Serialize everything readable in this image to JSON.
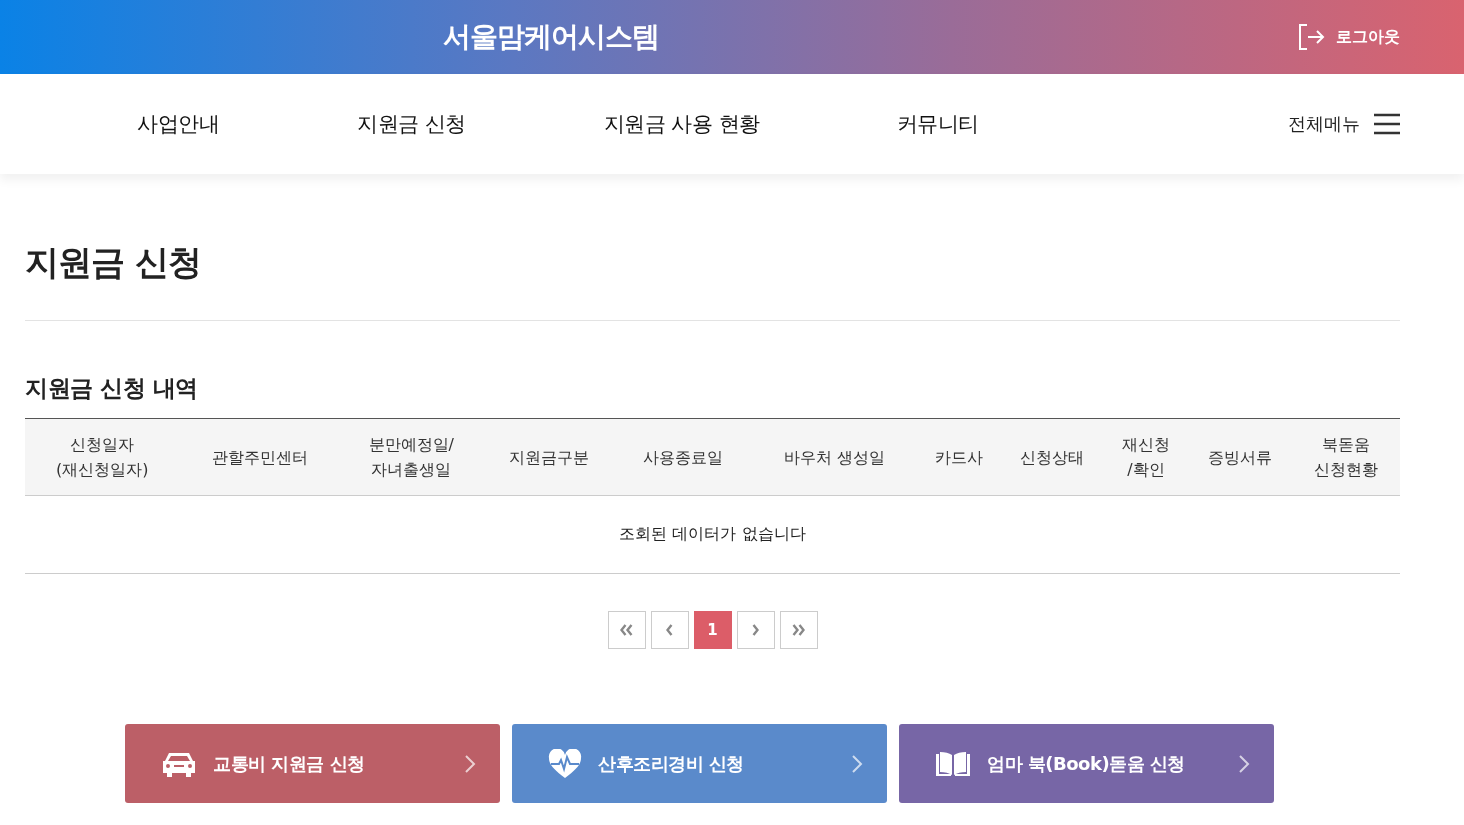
{
  "header": {
    "title": "서울맘케어시스템",
    "logout": "로그아웃"
  },
  "nav": {
    "items": [
      {
        "label": "사업안내"
      },
      {
        "label": "지원금 신청"
      },
      {
        "label": "지원금 사용 현황"
      },
      {
        "label": "커뮤니티"
      }
    ],
    "all_menu": "전체메뉴"
  },
  "page_title": "지원금 신청",
  "section_title": "지원금 신청 내역",
  "table": {
    "columns": [
      {
        "label": "신청일자\n(재신청일자)"
      },
      {
        "label": "관할주민센터"
      },
      {
        "label": "분만예정일/\n자녀출생일"
      },
      {
        "label": "지원금구분"
      },
      {
        "label": "사용종료일"
      },
      {
        "label": "바우처 생성일"
      },
      {
        "label": "카드사"
      },
      {
        "label": "신청상태"
      },
      {
        "label": "재신청\n/확인"
      },
      {
        "label": "증빙서류"
      },
      {
        "label": "북돋움\n신청현황"
      }
    ],
    "empty_message": "조회된 데이터가 없습니다"
  },
  "pagination": [
    {
      "kind": "first"
    },
    {
      "kind": "prev"
    },
    {
      "kind": "page",
      "label": "1",
      "selected": true
    },
    {
      "kind": "next"
    },
    {
      "kind": "last"
    }
  ],
  "quick_links": [
    {
      "kind": "car",
      "label": "교통비 지원금 신청",
      "color": "#bc5f67"
    },
    {
      "kind": "heart",
      "label": "산후조리경비 신청",
      "color": "#5a8acb"
    },
    {
      "kind": "book",
      "label": "엄마 북(Book)돋움 신청",
      "color": "#7766a6"
    }
  ]
}
